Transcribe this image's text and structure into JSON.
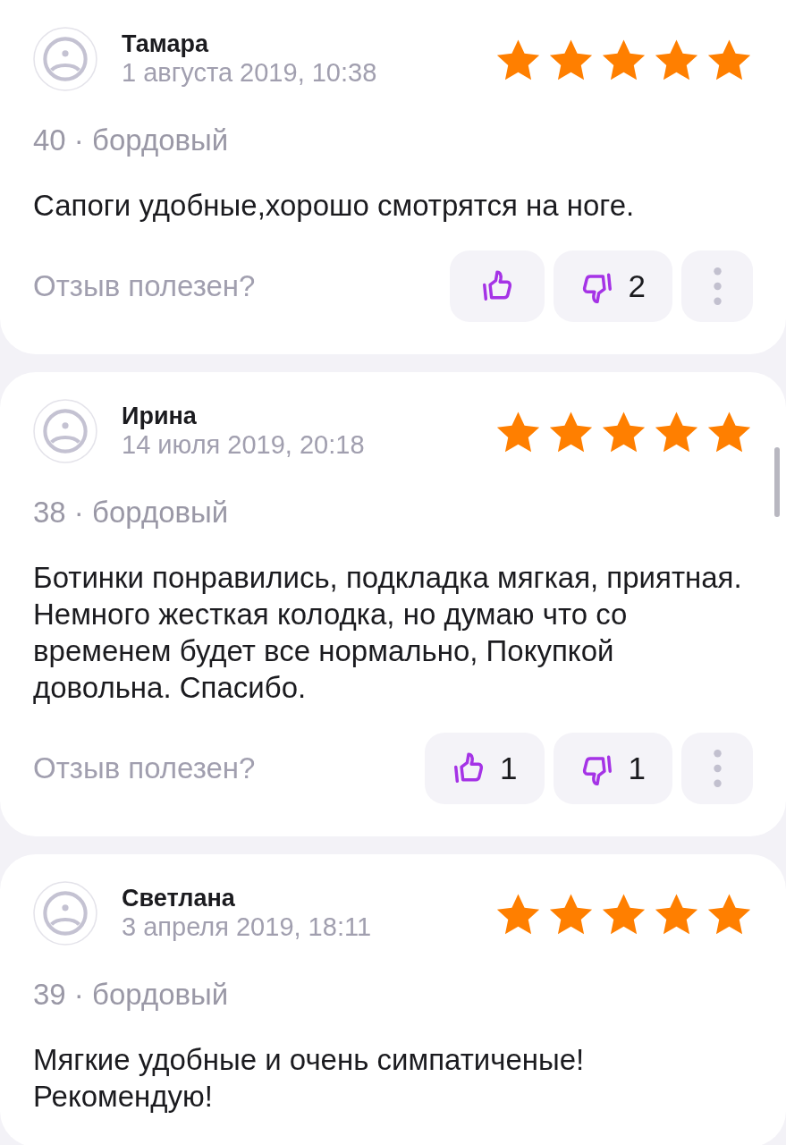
{
  "reviews": [
    {
      "name": "Тамара",
      "date": "1 августа 2019, 10:38",
      "stars": 5,
      "variant": "40 · бордовый",
      "text": "Сапоги удобные,хорошо смотрятся на ноге.",
      "feedback": {
        "question": "Отзыв полезен?",
        "dislikes": "2"
      }
    },
    {
      "name": "Ирина",
      "date": "14 июля 2019, 20:18",
      "stars": 5,
      "variant": "38 · бордовый",
      "text": "Ботинки понравились, подкладка мягкая, приятная. Немного жесткая колодка, но думаю что со временем будет все нормально, Покупкой довольна. Спасибо.",
      "feedback": {
        "question": "Отзыв полезен?",
        "likes": "1",
        "dislikes": "1"
      }
    },
    {
      "name": "Светлана",
      "date": "3 апреля 2019, 18:11",
      "stars": 5,
      "variant": "39 · бордовый",
      "text": "Мягкие удобные и очень симпатиченые! Рекомендую!"
    }
  ]
}
